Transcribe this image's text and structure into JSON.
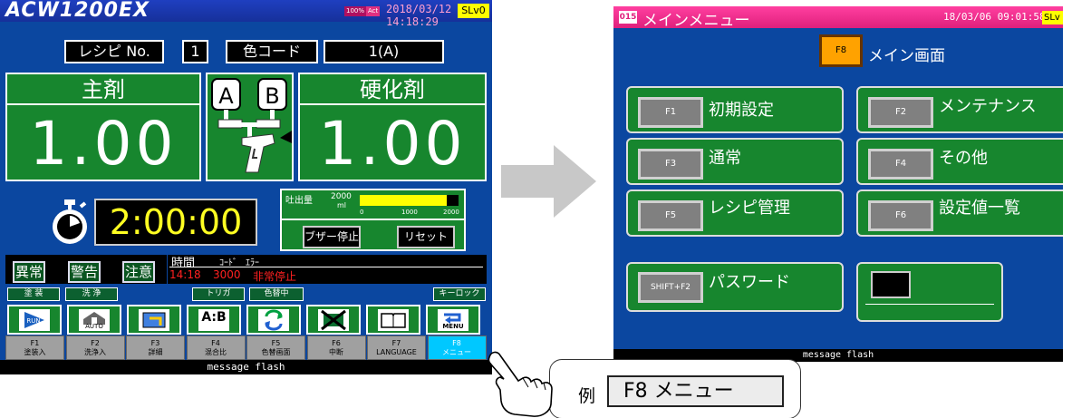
{
  "left_screen": {
    "app_name": "ACW1200EX",
    "badge_100": "100%",
    "badge_act": "Act",
    "datetime": "2018/03/12 14:18:29",
    "security_level": "SLv0",
    "recipe_label": "レシピ No.",
    "recipe_no": "1",
    "color_code_label": "色コード",
    "color_code_value": "1(A)",
    "main_agent_label": "主剤",
    "main_agent_value": "1.00",
    "hardener_label": "硬化剤",
    "hardener_value": "1.00",
    "tank_a": "A",
    "tank_b": "B",
    "timer_value": "2:00:00",
    "discharge_label": "吐出量",
    "discharge_max": "2000",
    "discharge_unit": "ml",
    "scale_0": "0",
    "scale_1000": "1000",
    "scale_2000": "2000",
    "discharge_level": 0.88,
    "buzzer_stop": "ブザー停止",
    "reset": "リセット",
    "alarm_abnormal": "異常",
    "alarm_warning": "警告",
    "alarm_caution": "注意",
    "msg_header_time": "時間",
    "msg_header_code": "ｺｰﾄﾞ",
    "msg_header_error": "ｴﾗｰ",
    "msg_row_time": "14:18",
    "msg_row_code": "3000",
    "msg_row_text": "非常停止",
    "status_painting": "塗 装",
    "status_cleaning": "洗 浄",
    "status_trigger": "トリガ",
    "status_color_change": "色替中",
    "status_key_lock": "キーロック",
    "icon_auto_label": "AUTO",
    "icon_ab_label": "A:B",
    "icon_menu_label": "MENU",
    "fkeys": [
      {
        "code": "F1",
        "label": "塗装入"
      },
      {
        "code": "F2",
        "label": "洗浄入"
      },
      {
        "code": "F3",
        "label": "詳細"
      },
      {
        "code": "F4",
        "label": "混合比"
      },
      {
        "code": "F5",
        "label": "色替画面"
      },
      {
        "code": "F6",
        "label": "中断"
      },
      {
        "code": "F7",
        "label": "LANGUAGE"
      },
      {
        "code": "F8",
        "label": "メニュー"
      }
    ],
    "message_flash": "message flash"
  },
  "right_screen": {
    "screen_no": "015",
    "title": "メインメニュー",
    "datetime": "18/03/06 09:01:58",
    "security_level": "SLv",
    "f8_key": "F8",
    "main_screen_label": "メイン画面",
    "menu_items": [
      {
        "key": "F1",
        "label": "初期設定"
      },
      {
        "key": "F2",
        "label": "メンテナンス"
      },
      {
        "key": "F3",
        "label": "通常"
      },
      {
        "key": "F4",
        "label": "その他"
      },
      {
        "key": "F5",
        "label": "レシピ管理"
      },
      {
        "key": "F6",
        "label": "設定値一覧"
      }
    ],
    "password_key": "SHIFT+F2",
    "password_label": "パスワード",
    "message_flash": "message flash"
  },
  "callout": {
    "example_label": "例",
    "key_text": "F8 メニュー"
  },
  "colors": {
    "screen_bg": "#0b47a0",
    "panel_green": "#17862e",
    "title_left": "#16309a",
    "title_right": "#e0207c",
    "accent_yellow": "#ffff00",
    "alarm_red": "#ff2020",
    "f8_orange": "#ffa200"
  }
}
